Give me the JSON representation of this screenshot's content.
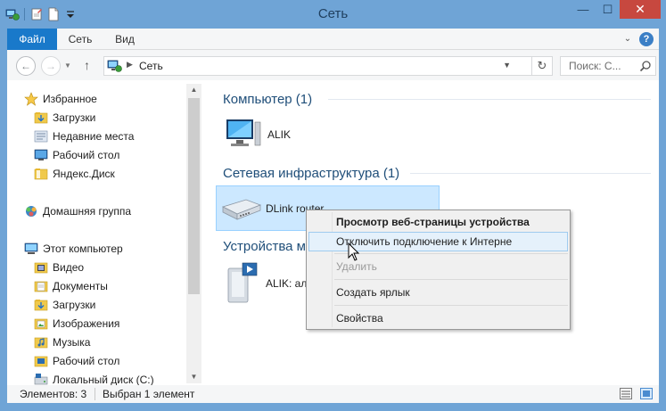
{
  "window": {
    "title": "Сеть",
    "minimize_icon": "minimize-icon",
    "maximize_icon": "maximize-icon",
    "close_icon": "close-icon",
    "close_glyph": "✕",
    "minimize_glyph": "—",
    "maximize_glyph": "☐"
  },
  "ribbon": {
    "tabs": [
      {
        "label": "Файл",
        "active": true
      },
      {
        "label": "Сеть"
      },
      {
        "label": "Вид"
      }
    ],
    "help_glyph": "?",
    "expand_glyph": "⌄"
  },
  "navigation": {
    "back_glyph": "←",
    "forward_glyph": "→",
    "up_glyph": "↑",
    "address_path": "Сеть",
    "search_placeholder": "Поиск: С...",
    "refresh_glyph": "↻"
  },
  "sidebar": {
    "favorites": {
      "label": "Избранное",
      "items": [
        "Загрузки",
        "Недавние места",
        "Рабочий стол",
        "Яндекс.Диск"
      ]
    },
    "homegroup": "Домашняя группа",
    "computer": {
      "label": "Этот компьютер",
      "items": [
        "Видео",
        "Документы",
        "Загрузки",
        "Изображения",
        "Музыка",
        "Рабочий стол",
        "Локальный диск (C:)"
      ]
    }
  },
  "groups": [
    {
      "title": "Компьютер (1)",
      "devices": [
        "ALIK"
      ]
    },
    {
      "title": "Сетевая инфраструктура (1)",
      "devices": [
        "DLink router"
      ]
    },
    {
      "title": "Устройства м",
      "devices": [
        "ALIK: ал"
      ]
    }
  ],
  "context_menu": {
    "items": [
      {
        "label": "Просмотр веб-страницы устройства",
        "bold": true
      },
      {
        "label": "Отключить подключение к Интерне",
        "hover": true
      },
      {
        "label": "Удалить",
        "disabled": true
      },
      {
        "label": "Создать ярлык"
      },
      {
        "label": "Свойства"
      }
    ]
  },
  "status": {
    "items_count": "Элементов: 3",
    "selection": "Выбран 1 элемент"
  },
  "colors": {
    "title_bar": "#6fa4d6",
    "file_tab": "#1979ca",
    "close_button": "#c7483f",
    "group_heading": "#1f4e79",
    "selection": "#cce8ff"
  }
}
